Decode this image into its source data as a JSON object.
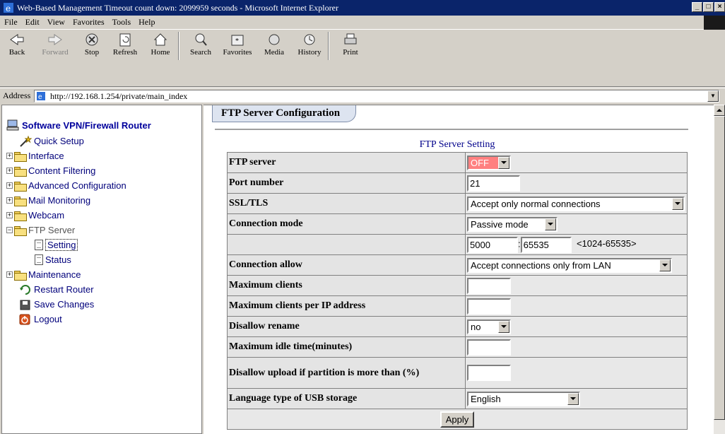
{
  "window": {
    "title": "Web-Based Management Timeout count down: 2099959 seconds - Microsoft Internet Explorer"
  },
  "menu": [
    "File",
    "Edit",
    "View",
    "Favorites",
    "Tools",
    "Help"
  ],
  "toolbar": {
    "back": "Back",
    "forward": "Forward",
    "stop": "Stop",
    "refresh": "Refresh",
    "home": "Home",
    "search": "Search",
    "favorites": "Favorites",
    "media": "Media",
    "history": "History",
    "print": "Print"
  },
  "address": {
    "label": "Address",
    "url": "http://192.168.1.254/private/main_index"
  },
  "sidebar": {
    "title": "Software VPN/Firewall Router",
    "items": [
      {
        "label": "Quick Setup"
      },
      {
        "label": "Interface"
      },
      {
        "label": "Content Filtering"
      },
      {
        "label": "Advanced Configuration"
      },
      {
        "label": "Mail Monitoring"
      },
      {
        "label": "Webcam"
      },
      {
        "label": "FTP Server"
      },
      {
        "label": "Setting"
      },
      {
        "label": "Status"
      },
      {
        "label": "Maintenance"
      },
      {
        "label": "Restart Router"
      },
      {
        "label": "Save Changes"
      },
      {
        "label": "Logout"
      }
    ]
  },
  "main": {
    "tab": "FTP Server Configuration",
    "caption": "FTP Server Setting",
    "rows": {
      "ftp_server": {
        "label": "FTP server",
        "value": "OFF"
      },
      "port": {
        "label": "Port number",
        "value": "21"
      },
      "ssl": {
        "label": "SSL/TLS",
        "value": "Accept only normal connections"
      },
      "conn_mode": {
        "label": "Connection mode",
        "value": "Passive mode"
      },
      "port_range": {
        "from": "5000",
        "sep": ":",
        "to": "65535",
        "hint": "<1024-65535>"
      },
      "conn_allow": {
        "label": "Connection allow",
        "value": "Accept connections only from LAN"
      },
      "max_clients": {
        "label": "Maximum clients",
        "value": ""
      },
      "max_per_ip": {
        "label": "Maximum clients per IP address",
        "value": ""
      },
      "disallow_rename": {
        "label": "Disallow rename",
        "value": "no"
      },
      "idle": {
        "label": "Maximum idle time(minutes)",
        "value": ""
      },
      "upload_limit": {
        "label": "Disallow upload if partition is more than (%)",
        "value": ""
      },
      "language": {
        "label": "Language type of USB storage",
        "value": "English"
      }
    },
    "apply": "Apply"
  },
  "colors": {
    "title_bar": "#0a246a",
    "link_text": "#00007b",
    "off_bg": "#ff8080"
  }
}
